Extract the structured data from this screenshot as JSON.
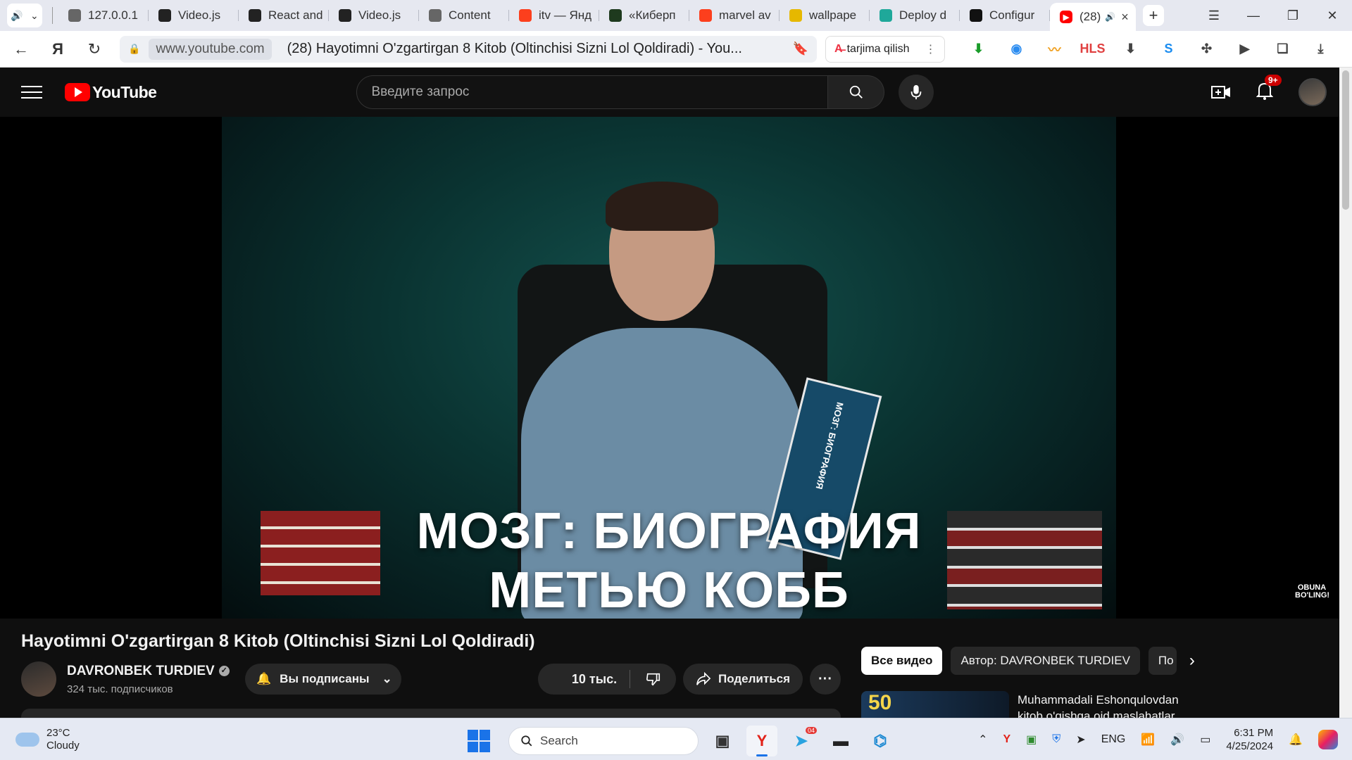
{
  "browser": {
    "tabs": [
      {
        "label": "127.0.0.1",
        "icon": "doc-icon",
        "color": "#666"
      },
      {
        "label": "Video.js",
        "icon": "videojs-icon",
        "color": "#222"
      },
      {
        "label": "React and",
        "icon": "videojs-icon",
        "color": "#222"
      },
      {
        "label": "Video.js",
        "icon": "videojs-icon",
        "color": "#222"
      },
      {
        "label": "Content",
        "icon": "doc-icon",
        "color": "#666"
      },
      {
        "label": "itv — Янд",
        "icon": "yandex-icon",
        "color": "#fc3f1d"
      },
      {
        "label": "«Киберп",
        "icon": "site-icon",
        "color": "#1e3a1e"
      },
      {
        "label": "marvel av",
        "icon": "yandex-icon",
        "color": "#fc3f1d"
      },
      {
        "label": "wallpape",
        "icon": "image-icon",
        "color": "#e6b800"
      },
      {
        "label": "Deploy d",
        "icon": "deploy-icon",
        "color": "#1fa89a"
      },
      {
        "label": "Configur",
        "icon": "next-icon",
        "color": "#111"
      }
    ],
    "active_tab": {
      "label": "(28)",
      "icon": "youtube-icon"
    },
    "address": {
      "domain": "www.youtube.com",
      "page_title": "(28) Hayotimni O'zgartirgan 8 Kitob (Oltinchisi Sizni Lol Qoldiradi) - You..."
    },
    "translate_label": "tarjima qilish",
    "extensions": [
      {
        "name": "download-green-icon",
        "glyph": "⬇",
        "color": "#1a9c2a"
      },
      {
        "name": "browser-ext-icon",
        "glyph": "◉",
        "color": "#2b8cf0"
      },
      {
        "name": "audio-wave-icon",
        "glyph": "〰",
        "color": "#f0a020"
      },
      {
        "name": "hls-icon",
        "glyph": "HLS",
        "color": "#e04040"
      },
      {
        "name": "download-icon",
        "glyph": "⬇",
        "color": "#444"
      },
      {
        "name": "shazam-icon",
        "glyph": "S",
        "color": "#1a8cf0"
      },
      {
        "name": "puzzle-icon",
        "glyph": "✣",
        "color": "#444"
      },
      {
        "name": "media-play-icon",
        "glyph": "▶",
        "color": "#444"
      },
      {
        "name": "collections-icon",
        "glyph": "❏",
        "color": "#444"
      },
      {
        "name": "downloads-tray-icon",
        "glyph": "⤓",
        "color": "#444"
      }
    ]
  },
  "youtube": {
    "logo_text": "YouTube",
    "search_placeholder": "Введите запрос",
    "notifications_badge": "9+",
    "video": {
      "caption_line1": "МОЗГ: БИОГРАФИЯ",
      "caption_line2": "МЕТЬЮ КОББ",
      "book_spine": "МОЗГ: БИОГРАФИЯ",
      "watermark": "OBUNA BO'LING!"
    },
    "title": "Hayotimni O'zgartirgan 8 Kitob (Oltinchisi Sizni Lol Qoldiradi)",
    "channel": {
      "name": "DAVRONBEK TURDIEV",
      "subscribers": "324 тыс. подписчиков",
      "subscribe_label": "Вы подписаны"
    },
    "likes": "10 тыс.",
    "share_label": "Поделиться",
    "chips": [
      "Все видео",
      "Автор: DAVRONBEK TURDIEV",
      "По"
    ],
    "recommendation": {
      "thumb_text": "50",
      "title": "Muhammadali Eshonqulovdan kitob o'qishga oid maslahatlar"
    }
  },
  "taskbar": {
    "weather_temp": "23°C",
    "weather_desc": "Cloudy",
    "search_label": "Search",
    "telegram_badge": "04",
    "language": "ENG",
    "time": "6:31 PM",
    "date": "4/25/2024"
  }
}
